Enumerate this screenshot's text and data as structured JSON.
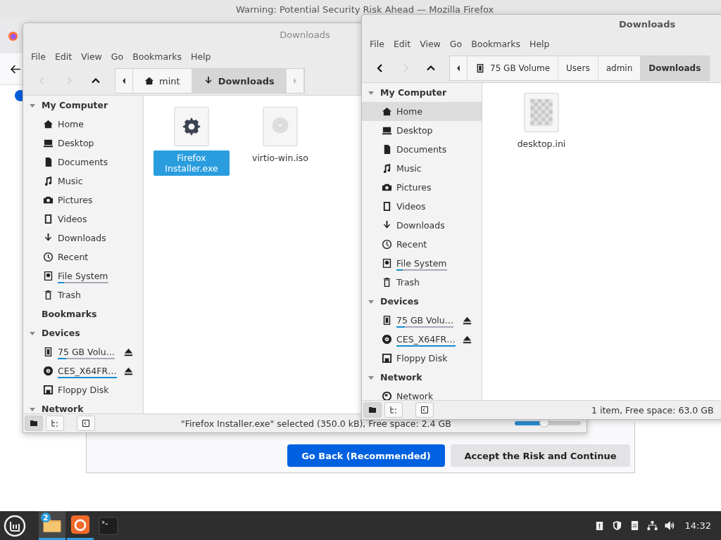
{
  "browser": {
    "title": "Warning: Potential Security Risk Ahead — Mozilla Firefox",
    "buttons": [
      {
        "label": "Go Back (Recommended)",
        "kind": "primary"
      },
      {
        "label": "Accept the Risk and Continue",
        "kind": "secondary"
      }
    ]
  },
  "windows": [
    {
      "title": "Downloads",
      "menu": [
        "File",
        "Edit",
        "View",
        "Go",
        "Bookmarks",
        "Help"
      ],
      "nav": [
        {
          "kind": "back",
          "disabled": true
        },
        {
          "kind": "forward",
          "disabled": true
        },
        {
          "kind": "up",
          "disabled": false
        }
      ],
      "path": [
        {
          "label": "mint",
          "kind": "home",
          "selected": false
        },
        {
          "label": "Downloads",
          "kind": "download",
          "selected": true
        }
      ],
      "path_more_right": true,
      "sidebar": [
        {
          "heading": "My Computer",
          "expanded": true,
          "items": [
            {
              "label": "Home",
              "kind": "home",
              "selected": false
            },
            {
              "label": "Desktop",
              "kind": "desktop",
              "selected": false
            },
            {
              "label": "Documents",
              "kind": "documents",
              "selected": false
            },
            {
              "label": "Music",
              "kind": "music",
              "selected": false
            },
            {
              "label": "Pictures",
              "kind": "pictures",
              "selected": false
            },
            {
              "label": "Videos",
              "kind": "videos",
              "selected": false
            },
            {
              "label": "Downloads",
              "kind": "download",
              "selected": false
            },
            {
              "label": "Recent",
              "kind": "recent",
              "selected": false
            },
            {
              "label": "File System",
              "kind": "filesystem",
              "selected": false,
              "level": 0.12
            },
            {
              "label": "Trash",
              "kind": "trash",
              "selected": false
            }
          ]
        },
        {
          "heading": "Bookmarks"
        },
        {
          "heading": "Devices",
          "expanded": true,
          "items": [
            {
              "label": "75 GB Volu…",
              "kind": "drive",
              "selected": false,
              "eject": true,
              "level": 0.15
            },
            {
              "label": "CES_X64FR…",
              "kind": "disc",
              "selected": false,
              "eject": true,
              "level": 1
            },
            {
              "label": "Floppy Disk",
              "kind": "floppy",
              "selected": false
            }
          ]
        },
        {
          "heading": "Network",
          "expanded": true
        }
      ],
      "files": [
        {
          "name": "Firefox Installer.exe",
          "kind": "executable",
          "selected": true
        },
        {
          "name": "virtio-win.iso",
          "kind": "disc",
          "selected": false
        }
      ],
      "status_buttons": [
        {
          "kind": "places",
          "selected": true
        },
        {
          "kind": "tree",
          "selected": false
        },
        {
          "kind": "toggle",
          "selected": false
        }
      ],
      "status": "\"Firefox Installer.exe\" selected (350.0 kB), Free space: 2.4 GB",
      "zoom": {
        "level": 0.45
      }
    },
    {
      "title": "Downloads",
      "menu": [
        "File",
        "Edit",
        "View",
        "Go",
        "Bookmarks",
        "Help"
      ],
      "nav": [
        {
          "kind": "back",
          "disabled": false
        },
        {
          "kind": "forward",
          "disabled": true
        },
        {
          "kind": "up",
          "disabled": false
        }
      ],
      "path": [
        {
          "label": "75 GB Volume",
          "kind": "drive",
          "selected": false
        },
        {
          "label": "Users",
          "selected": false
        },
        {
          "label": "admin",
          "selected": false
        },
        {
          "label": "Downloads",
          "selected": true
        }
      ],
      "sidebar": [
        {
          "heading": "My Computer",
          "expanded": true,
          "items": [
            {
              "label": "Home",
              "kind": "home",
              "selected": true
            },
            {
              "label": "Desktop",
              "kind": "desktop",
              "selected": false
            },
            {
              "label": "Documents",
              "kind": "documents",
              "selected": false
            },
            {
              "label": "Music",
              "kind": "music",
              "selected": false
            },
            {
              "label": "Pictures",
              "kind": "pictures",
              "selected": false
            },
            {
              "label": "Videos",
              "kind": "videos",
              "selected": false
            },
            {
              "label": "Downloads",
              "kind": "download",
              "selected": false
            },
            {
              "label": "Recent",
              "kind": "recent",
              "selected": false
            },
            {
              "label": "File System",
              "kind": "filesystem",
              "selected": false,
              "level": 0.12
            },
            {
              "label": "Trash",
              "kind": "trash",
              "selected": false
            }
          ]
        },
        {
          "heading": "Devices",
          "expanded": true,
          "items": [
            {
              "label": "75 GB Volu…",
              "kind": "drive",
              "selected": false,
              "eject": true,
              "level": 0.15
            },
            {
              "label": "CES_X64FR…",
              "kind": "disc",
              "selected": false,
              "eject": true,
              "level": 1
            },
            {
              "label": "Floppy Disk",
              "kind": "floppy",
              "selected": false
            }
          ]
        },
        {
          "heading": "Network",
          "expanded": true,
          "items": [
            {
              "label": "Network",
              "kind": "network",
              "selected": false
            }
          ]
        }
      ],
      "files": [
        {
          "name": "desktop.ini",
          "kind": "blank",
          "selected": false
        }
      ],
      "status_buttons": [
        {
          "kind": "places",
          "selected": true
        },
        {
          "kind": "tree",
          "selected": false
        },
        {
          "kind": "toggle",
          "selected": false
        }
      ],
      "status": "1 item, Free space: 63.0 GB"
    }
  ],
  "taskbar": {
    "apps": [
      {
        "kind": "files",
        "running": true,
        "focused": true,
        "badge": "2"
      },
      {
        "kind": "firefox",
        "running": true,
        "focused": false
      },
      {
        "kind": "terminal",
        "running": false,
        "focused": false
      }
    ],
    "tray": [
      {
        "kind": "clipboard"
      },
      {
        "kind": "shield"
      },
      {
        "kind": "notes"
      },
      {
        "kind": "network"
      },
      {
        "kind": "volume"
      }
    ],
    "clock": "14:32"
  }
}
